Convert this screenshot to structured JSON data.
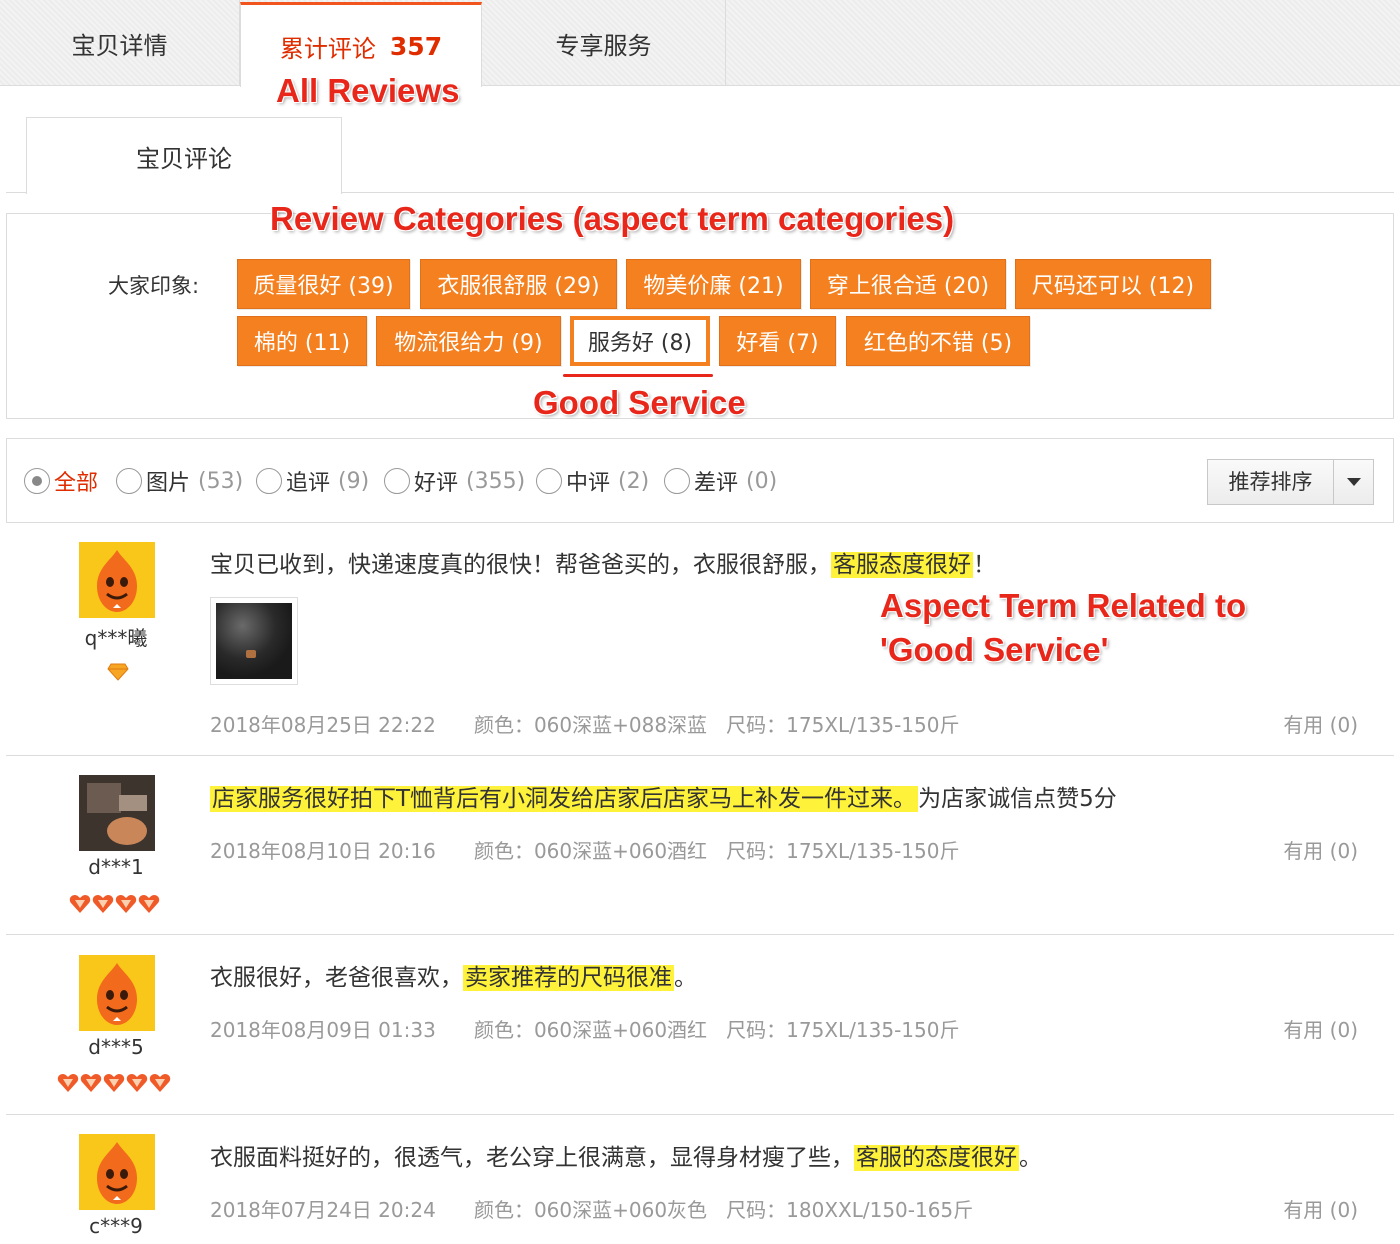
{
  "tabs": {
    "details": "宝贝详情",
    "reviews_label": "累计评论",
    "reviews_count": "357",
    "services": "专享服务"
  },
  "annotations": {
    "all_reviews": "All Reviews",
    "categories": "Review Categories (aspect term categories)",
    "good_service": "Good Service",
    "aspect_line1": "Aspect Term Related to",
    "aspect_line2": "'Good Service'"
  },
  "subtab": {
    "label": "宝贝评论"
  },
  "impressions": {
    "label": "大家印象:",
    "chips": [
      "质量很好 (39)",
      "衣服很舒服 (29)",
      "物美价廉 (21)",
      "穿上很合适 (20)",
      "尺码还可以 (12)",
      "棉的 (11)",
      "物流很给力 (9)",
      "服务好 (8)",
      "好看 (7)",
      "红色的不错 (5)"
    ],
    "selected": "服务好 (8)"
  },
  "filters": [
    {
      "label": "全部",
      "count": ""
    },
    {
      "label": "图片",
      "count": "(53)"
    },
    {
      "label": "追评",
      "count": "(9)"
    },
    {
      "label": "好评",
      "count": "(355)"
    },
    {
      "label": "中评",
      "count": "(2)"
    },
    {
      "label": "差评",
      "count": "(0)"
    }
  ],
  "active_filter": "全部",
  "sort": {
    "label": "推荐排序"
  },
  "reviews": [
    {
      "user": "q***曦",
      "medal_count": 1,
      "avatar": "mascot",
      "text_before": "宝贝已收到，快递速度真的很快！帮爸爸买的，衣服很舒服，",
      "highlight": "客服态度很好",
      "text_after": "！",
      "has_photo": true,
      "date": "2018年08月25日 22:22",
      "color": "颜色：060深蓝+088深蓝",
      "size": "尺码：175XL/135-150斤",
      "useful": "有用 (0)"
    },
    {
      "user": "d***1",
      "medal_count": 4,
      "avatar": "photo",
      "text_before": "",
      "highlight": "店家服务很好拍下T恤背后有小洞发给店家后店家马上补发一件过来。",
      "text_after": "为店家诚信点赞5分",
      "has_photo": false,
      "date": "2018年08月10日 20:16",
      "color": "颜色：060深蓝+060酒红",
      "size": "尺码：175XL/135-150斤",
      "useful": "有用 (0)"
    },
    {
      "user": "d***5",
      "medal_count": 5,
      "avatar": "mascot",
      "text_before": "衣服很好，老爸很喜欢，",
      "highlight": "卖家推荐的尺码很准",
      "text_after": "。",
      "has_photo": false,
      "date": "2018年08月09日 01:33",
      "color": "颜色：060深蓝+060酒红",
      "size": "尺码：175XL/135-150斤",
      "useful": "有用 (0)"
    },
    {
      "user": "c***9",
      "medal_count": 0,
      "avatar": "mascot",
      "text_before": "衣服面料挺好的，很透气，老公穿上很满意，显得身材瘦了些，",
      "highlight": "客服的态度很好",
      "text_after": "。",
      "has_photo": false,
      "date": "2018年07月24日 20:24",
      "color": "颜色：060深蓝+060灰色",
      "size": "尺码：180XXL/150-165斤",
      "useful": "有用 (0)"
    }
  ],
  "colors": {
    "accent_orange": "#f5801f",
    "annotation_red": "#e8261a",
    "highlight_yellow": "#fff23a",
    "tab_active_red": "#e02d00"
  }
}
